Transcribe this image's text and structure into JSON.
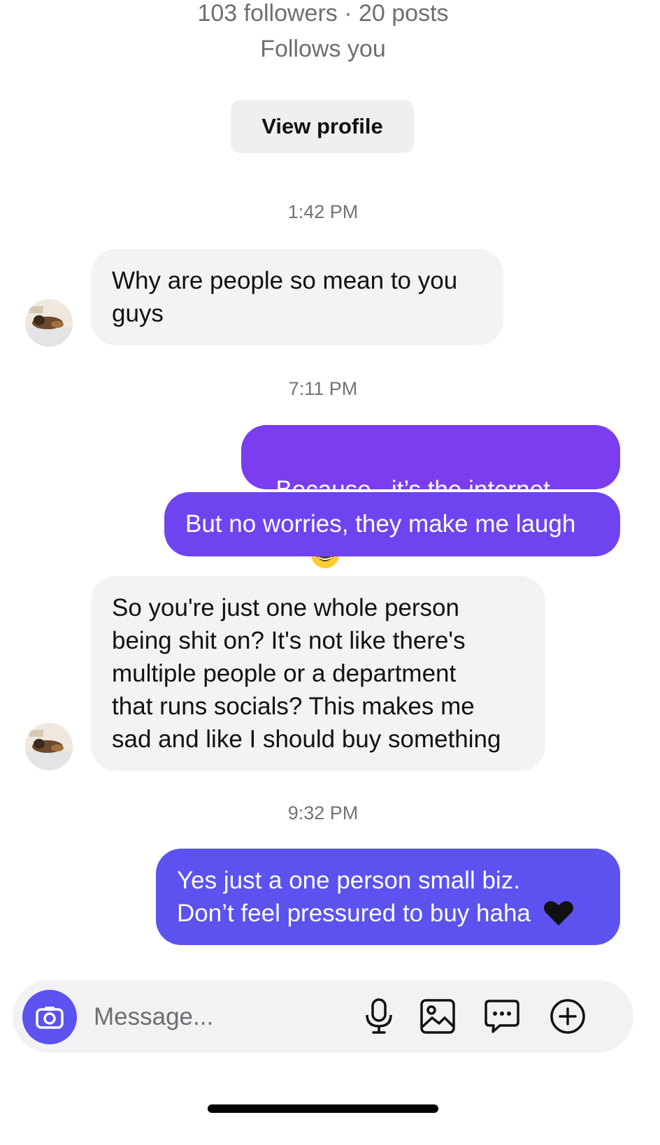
{
  "profile": {
    "stats": "103 followers · 20 posts",
    "follow_status": "Follows you",
    "view_profile_label": "View profile"
  },
  "conversation": [
    {
      "type": "timestamp",
      "text": "1:42 PM"
    },
    {
      "type": "incoming",
      "text": "Why are people so mean to you\nguys"
    },
    {
      "type": "timestamp",
      "text": "7:11 PM"
    },
    {
      "type": "outgoing",
      "text": "Because.. it’s the internet",
      "emoji": "grinning-sweat-emoji"
    },
    {
      "type": "outgoing",
      "text": "But no worries, they make me laugh"
    },
    {
      "type": "incoming",
      "text": "So you're just one whole person\nbeing shit on? It's not like there's\nmultiple people or a department\nthat runs socials? This makes me\nsad and like I should buy something"
    },
    {
      "type": "timestamp",
      "text": "9:32 PM"
    },
    {
      "type": "outgoing",
      "text": "Yes just a one person small biz.\nDon’t feel pressured to buy haha",
      "emoji": "black-heart-emoji"
    }
  ],
  "composer": {
    "placeholder": "Message...",
    "icons": [
      "camera-icon",
      "microphone-icon",
      "gallery-icon",
      "sticker-icon",
      "plus-icon"
    ]
  },
  "colors": {
    "outgoing_top": "#7b3ff0",
    "outgoing_bottom": "#5b52ef",
    "incoming_bg": "#f2f3f5",
    "accent": "#5b52ef"
  }
}
